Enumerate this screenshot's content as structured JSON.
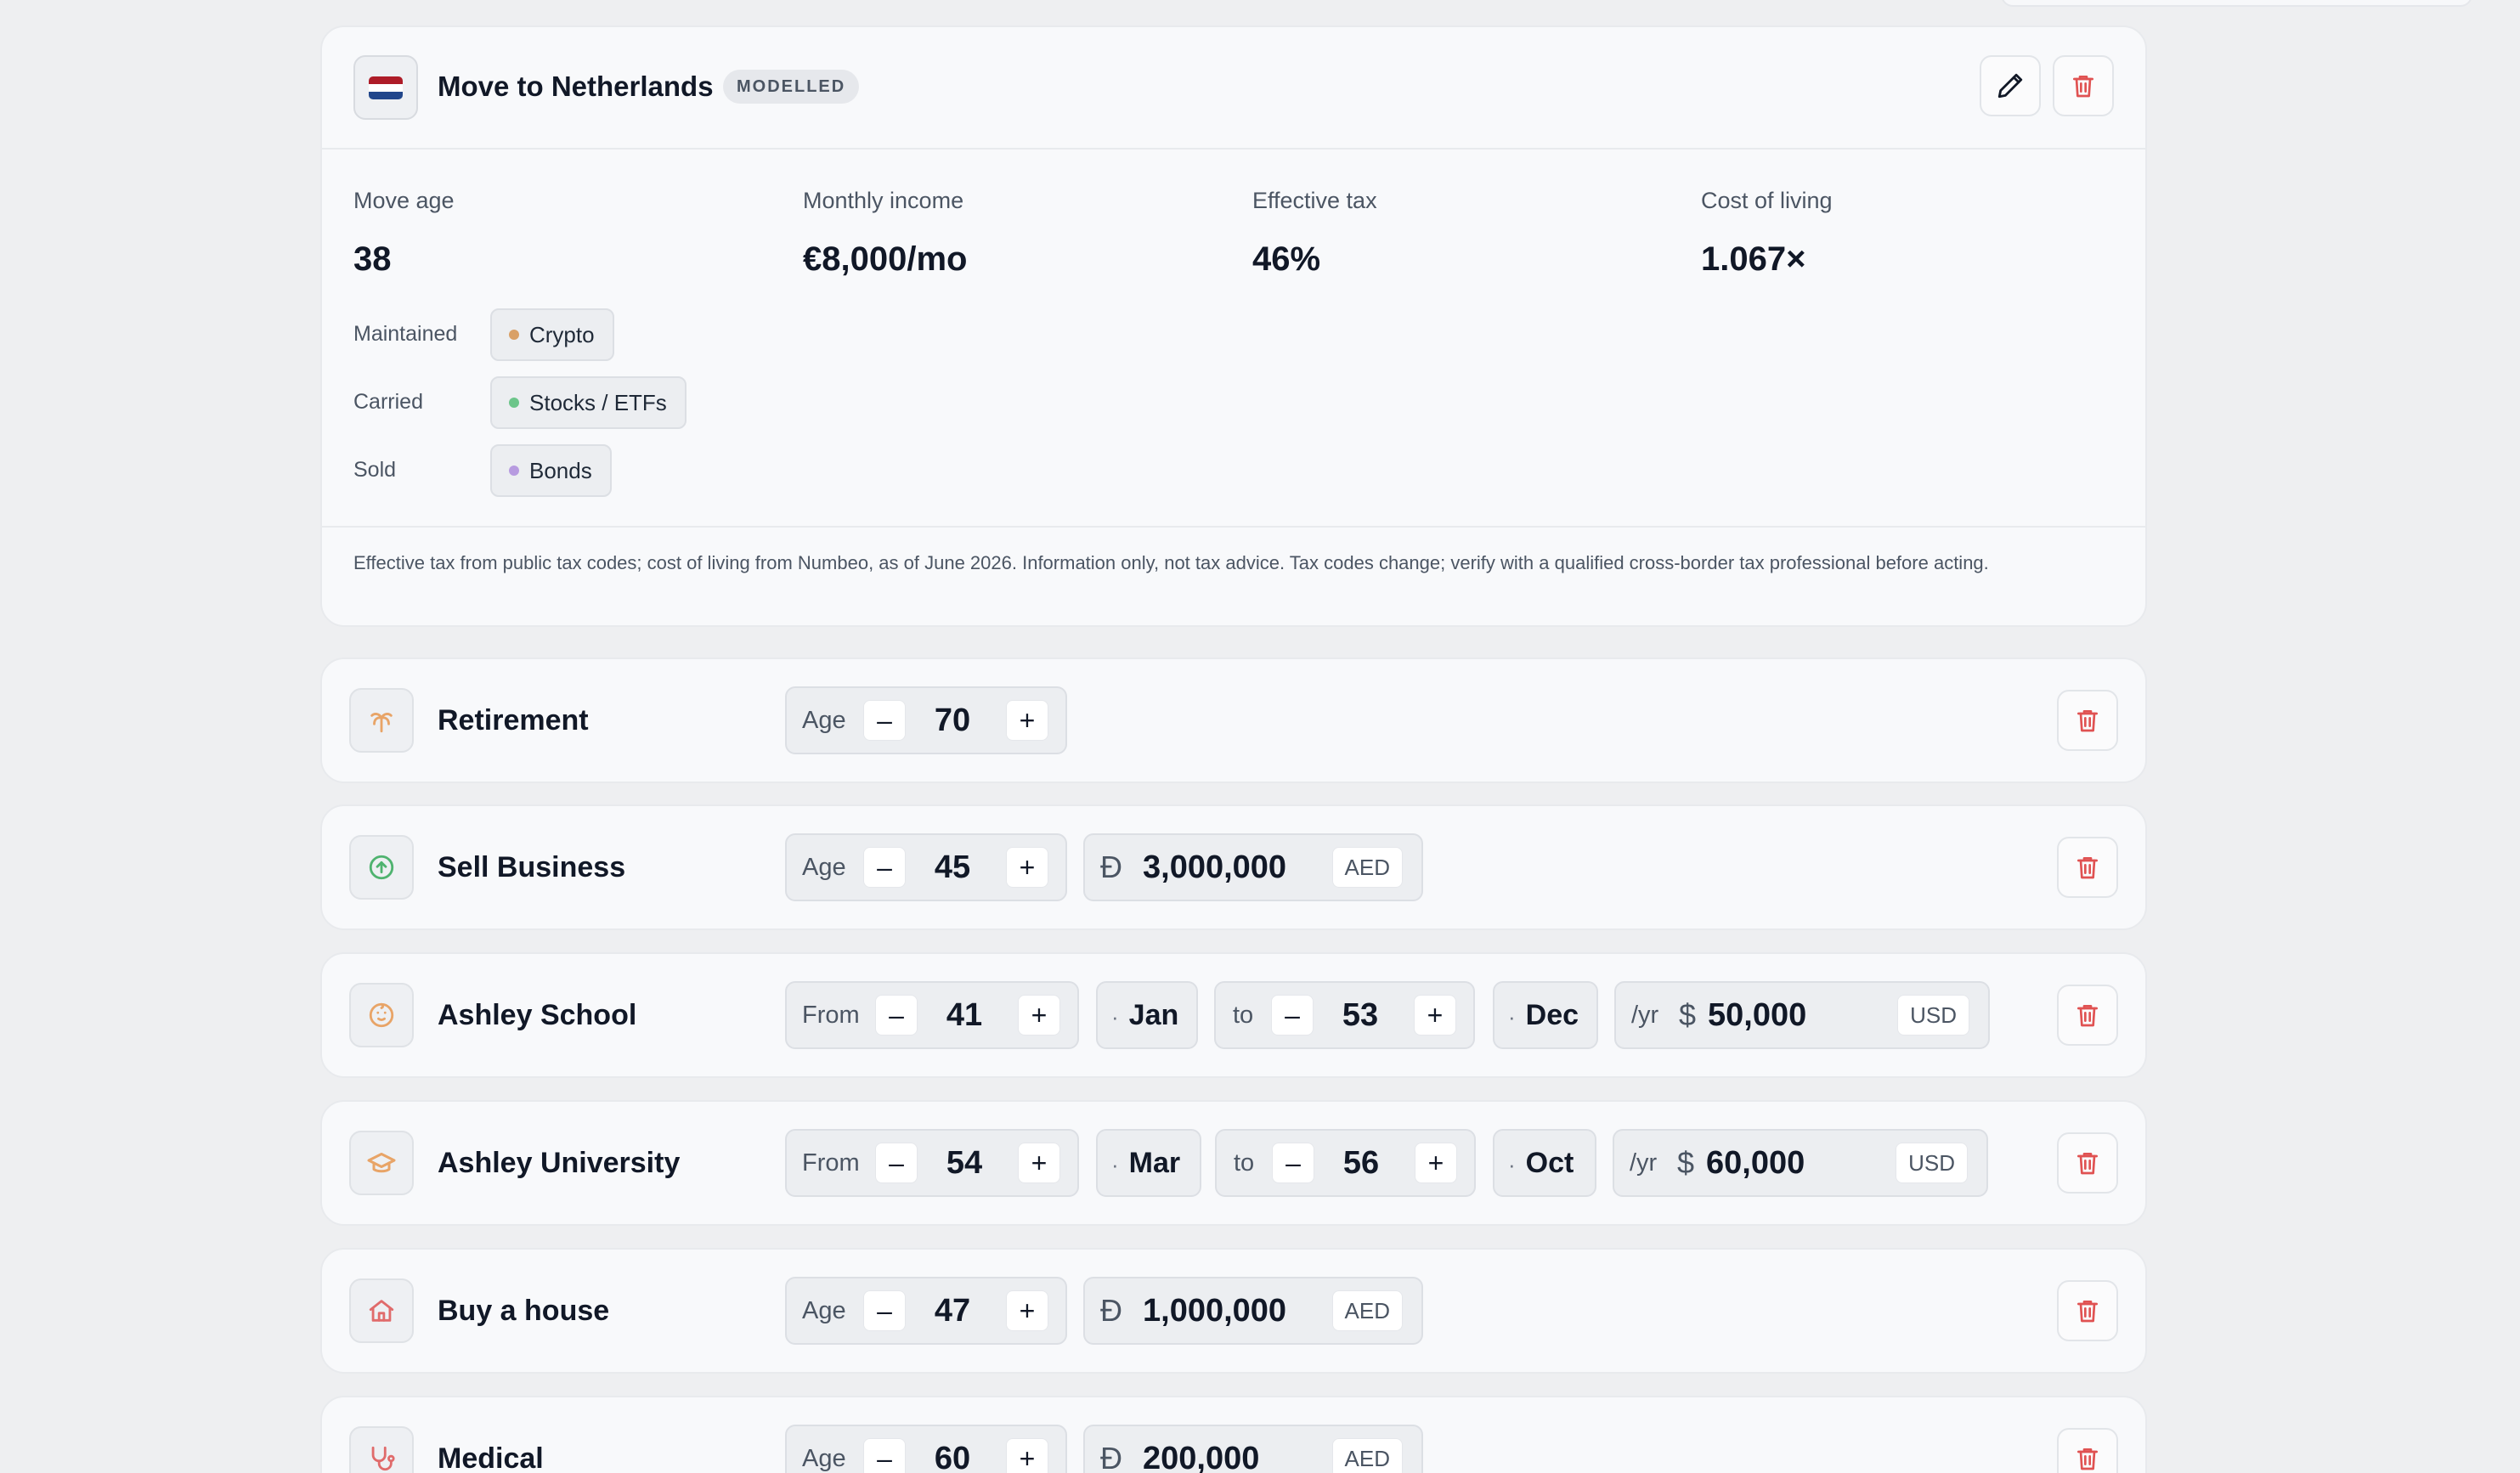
{
  "relocation": {
    "title": "Move to Netherlands",
    "badge": "MODELLED",
    "flag_colors": [
      "#ae1c28",
      "#ffffff",
      "#21468b"
    ],
    "stats": [
      {
        "label": "Move age",
        "value": "38"
      },
      {
        "label": "Monthly income",
        "value": "€8,000/mo"
      },
      {
        "label": "Effective tax",
        "value": "46%"
      },
      {
        "label": "Cost of living",
        "value": "1.067×"
      }
    ],
    "assets": [
      {
        "label": "Maintained",
        "chip": "Crypto",
        "dot_color": "#d9a066"
      },
      {
        "label": "Carried",
        "chip": "Stocks / ETFs",
        "dot_color": "#6cc58a"
      },
      {
        "label": "Sold",
        "chip": "Bonds",
        "dot_color": "#b79be0"
      }
    ],
    "disclaimer": "Effective tax from public tax codes; cost of living from Numbeo, as of June 2026. Information only, not tax advice. Tax codes change; verify with a qualified cross-border tax professional before acting.",
    "edit_icon": "pencil-icon",
    "delete_icon": "trash-icon"
  },
  "events": [
    {
      "title": "Retirement",
      "icon": "palm-tree-icon",
      "icon_color": "#e8a467",
      "age_label": "Age",
      "age": "70"
    },
    {
      "title": "Sell Business",
      "icon": "arrow-up-circle-icon",
      "icon_color": "#4fb36f",
      "age_label": "Age",
      "age": "45",
      "currency_symbol": "Đ",
      "amount": "3,000,000",
      "currency": "AED"
    },
    {
      "title": "Ashley School",
      "icon": "baby-icon",
      "icon_color": "#e8a467",
      "from_label": "From",
      "from_age": "41",
      "from_month": "Jan",
      "to_label": "to",
      "to_age": "53",
      "to_month": "Dec",
      "period_label": "/yr",
      "currency_symbol": "$",
      "amount": "50,000",
      "currency": "USD"
    },
    {
      "title": "Ashley University",
      "icon": "graduation-cap-icon",
      "icon_color": "#e8a467",
      "from_label": "From",
      "from_age": "54",
      "from_month": "Mar",
      "to_label": "to",
      "to_age": "56",
      "to_month": "Oct",
      "period_label": "/yr",
      "currency_symbol": "$",
      "amount": "60,000",
      "currency": "USD"
    },
    {
      "title": "Buy a house",
      "icon": "house-icon",
      "icon_color": "#e06b6b",
      "age_label": "Age",
      "age": "47",
      "currency_symbol": "Đ",
      "amount": "1,000,000",
      "currency": "AED"
    },
    {
      "title": "Medical",
      "icon": "stethoscope-icon",
      "icon_color": "#e06b6b",
      "age_label": "Age",
      "age": "60",
      "currency_symbol": "Đ",
      "amount": "200,000",
      "currency": "AED"
    }
  ],
  "controls": {
    "minus": "–",
    "plus": "+",
    "bullet": "·"
  },
  "colors": {
    "trash": "#e05252",
    "background": "#eeeff1",
    "card": "#f8f9fb"
  }
}
